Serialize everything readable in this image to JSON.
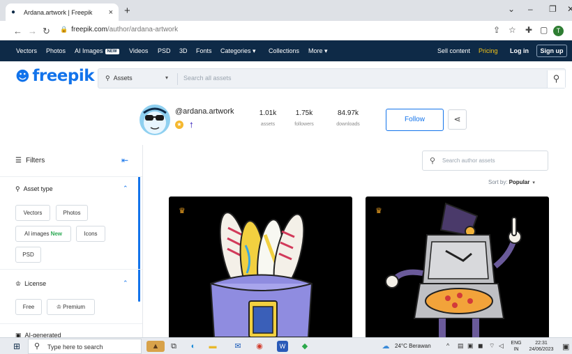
{
  "browser": {
    "tab_title": "Ardana.artwork | Freepik",
    "tab_close": "×",
    "new_tab": "+",
    "url_domain": "freepik.com",
    "url_path": "/author/ardana-artwork",
    "profile_initial": "T"
  },
  "nav": {
    "items": [
      "Vectors",
      "Photos",
      "AI Images",
      "Videos",
      "PSD",
      "3D",
      "Fonts",
      "Categories ▾",
      "Collections",
      "More ▾"
    ],
    "new_badge": "NEW",
    "sell": "Sell content",
    "pricing": "Pricing",
    "login": "Log in",
    "signup": "Sign up"
  },
  "search": {
    "logo": "freepik",
    "dropdown": "Assets",
    "placeholder": "Search all assets"
  },
  "author": {
    "handle": "@ardana.artwork",
    "stats": [
      {
        "value": "1.01k",
        "label": "assets"
      },
      {
        "value": "1.75k",
        "label": "followers"
      },
      {
        "value": "84.97k",
        "label": "downloads"
      }
    ],
    "follow": "Follow"
  },
  "sidebar": {
    "title": "Filters",
    "sections": [
      {
        "title": "Asset type"
      },
      {
        "title": "License"
      },
      {
        "title": "AI-generated"
      }
    ],
    "asset_chips": [
      "Vectors",
      "Photos",
      "AI images",
      "Icons",
      "PSD"
    ],
    "new_label": "New",
    "license_chips": [
      "Free",
      "Premium"
    ]
  },
  "main": {
    "author_search_placeholder": "Search author assets",
    "sort_label": "Sort by:",
    "sort_value": "Popular"
  },
  "taskbar": {
    "search_placeholder": "Type here to search",
    "weather": "24°C  Berawan",
    "lang1": "ENG",
    "lang2": "IN",
    "time": "22:31",
    "date": "24/06/2023"
  },
  "colors": {
    "brand_blue": "#1273eb",
    "nav_bg": "#0e2a47",
    "pricing_yellow": "#f5c518",
    "new_green": "#2eaa55"
  },
  "icons": [
    "freepik-logo-icon",
    "search-icon",
    "share-icon",
    "filters-icon",
    "collapse-icon",
    "asset-type-icon",
    "license-icon",
    "crown-icon",
    "windows-start-icon"
  ]
}
